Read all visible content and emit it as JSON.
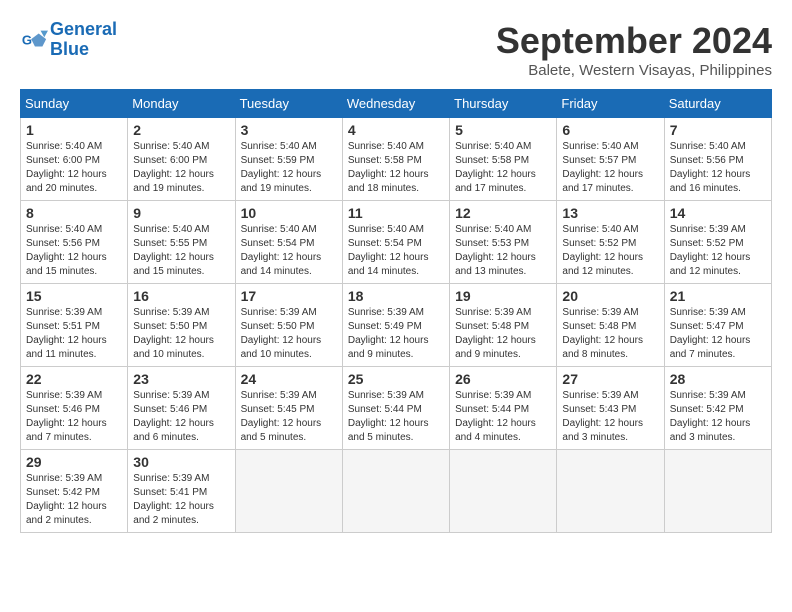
{
  "header": {
    "logo_line1": "General",
    "logo_line2": "Blue",
    "month_title": "September 2024",
    "subtitle": "Balete, Western Visayas, Philippines"
  },
  "calendar": {
    "days_of_week": [
      "Sunday",
      "Monday",
      "Tuesday",
      "Wednesday",
      "Thursday",
      "Friday",
      "Saturday"
    ],
    "weeks": [
      [
        {
          "day": "",
          "info": ""
        },
        {
          "day": "2",
          "info": "Sunrise: 5:40 AM\nSunset: 6:00 PM\nDaylight: 12 hours\nand 19 minutes."
        },
        {
          "day": "3",
          "info": "Sunrise: 5:40 AM\nSunset: 5:59 PM\nDaylight: 12 hours\nand 19 minutes."
        },
        {
          "day": "4",
          "info": "Sunrise: 5:40 AM\nSunset: 5:58 PM\nDaylight: 12 hours\nand 18 minutes."
        },
        {
          "day": "5",
          "info": "Sunrise: 5:40 AM\nSunset: 5:58 PM\nDaylight: 12 hours\nand 17 minutes."
        },
        {
          "day": "6",
          "info": "Sunrise: 5:40 AM\nSunset: 5:57 PM\nDaylight: 12 hours\nand 17 minutes."
        },
        {
          "day": "7",
          "info": "Sunrise: 5:40 AM\nSunset: 5:56 PM\nDaylight: 12 hours\nand 16 minutes."
        }
      ],
      [
        {
          "day": "8",
          "info": "Sunrise: 5:40 AM\nSunset: 5:56 PM\nDaylight: 12 hours\nand 15 minutes."
        },
        {
          "day": "9",
          "info": "Sunrise: 5:40 AM\nSunset: 5:55 PM\nDaylight: 12 hours\nand 15 minutes."
        },
        {
          "day": "10",
          "info": "Sunrise: 5:40 AM\nSunset: 5:54 PM\nDaylight: 12 hours\nand 14 minutes."
        },
        {
          "day": "11",
          "info": "Sunrise: 5:40 AM\nSunset: 5:54 PM\nDaylight: 12 hours\nand 14 minutes."
        },
        {
          "day": "12",
          "info": "Sunrise: 5:40 AM\nSunset: 5:53 PM\nDaylight: 12 hours\nand 13 minutes."
        },
        {
          "day": "13",
          "info": "Sunrise: 5:40 AM\nSunset: 5:52 PM\nDaylight: 12 hours\nand 12 minutes."
        },
        {
          "day": "14",
          "info": "Sunrise: 5:39 AM\nSunset: 5:52 PM\nDaylight: 12 hours\nand 12 minutes."
        }
      ],
      [
        {
          "day": "15",
          "info": "Sunrise: 5:39 AM\nSunset: 5:51 PM\nDaylight: 12 hours\nand 11 minutes."
        },
        {
          "day": "16",
          "info": "Sunrise: 5:39 AM\nSunset: 5:50 PM\nDaylight: 12 hours\nand 10 minutes."
        },
        {
          "day": "17",
          "info": "Sunrise: 5:39 AM\nSunset: 5:50 PM\nDaylight: 12 hours\nand 10 minutes."
        },
        {
          "day": "18",
          "info": "Sunrise: 5:39 AM\nSunset: 5:49 PM\nDaylight: 12 hours\nand 9 minutes."
        },
        {
          "day": "19",
          "info": "Sunrise: 5:39 AM\nSunset: 5:48 PM\nDaylight: 12 hours\nand 9 minutes."
        },
        {
          "day": "20",
          "info": "Sunrise: 5:39 AM\nSunset: 5:48 PM\nDaylight: 12 hours\nand 8 minutes."
        },
        {
          "day": "21",
          "info": "Sunrise: 5:39 AM\nSunset: 5:47 PM\nDaylight: 12 hours\nand 7 minutes."
        }
      ],
      [
        {
          "day": "22",
          "info": "Sunrise: 5:39 AM\nSunset: 5:46 PM\nDaylight: 12 hours\nand 7 minutes."
        },
        {
          "day": "23",
          "info": "Sunrise: 5:39 AM\nSunset: 5:46 PM\nDaylight: 12 hours\nand 6 minutes."
        },
        {
          "day": "24",
          "info": "Sunrise: 5:39 AM\nSunset: 5:45 PM\nDaylight: 12 hours\nand 5 minutes."
        },
        {
          "day": "25",
          "info": "Sunrise: 5:39 AM\nSunset: 5:44 PM\nDaylight: 12 hours\nand 5 minutes."
        },
        {
          "day": "26",
          "info": "Sunrise: 5:39 AM\nSunset: 5:44 PM\nDaylight: 12 hours\nand 4 minutes."
        },
        {
          "day": "27",
          "info": "Sunrise: 5:39 AM\nSunset: 5:43 PM\nDaylight: 12 hours\nand 3 minutes."
        },
        {
          "day": "28",
          "info": "Sunrise: 5:39 AM\nSunset: 5:42 PM\nDaylight: 12 hours\nand 3 minutes."
        }
      ],
      [
        {
          "day": "29",
          "info": "Sunrise: 5:39 AM\nSunset: 5:42 PM\nDaylight: 12 hours\nand 2 minutes."
        },
        {
          "day": "30",
          "info": "Sunrise: 5:39 AM\nSunset: 5:41 PM\nDaylight: 12 hours\nand 2 minutes."
        },
        {
          "day": "",
          "info": ""
        },
        {
          "day": "",
          "info": ""
        },
        {
          "day": "",
          "info": ""
        },
        {
          "day": "",
          "info": ""
        },
        {
          "day": "",
          "info": ""
        }
      ]
    ],
    "week0_day1": {
      "day": "1",
      "info": "Sunrise: 5:40 AM\nSunset: 6:00 PM\nDaylight: 12 hours\nand 20 minutes."
    }
  }
}
